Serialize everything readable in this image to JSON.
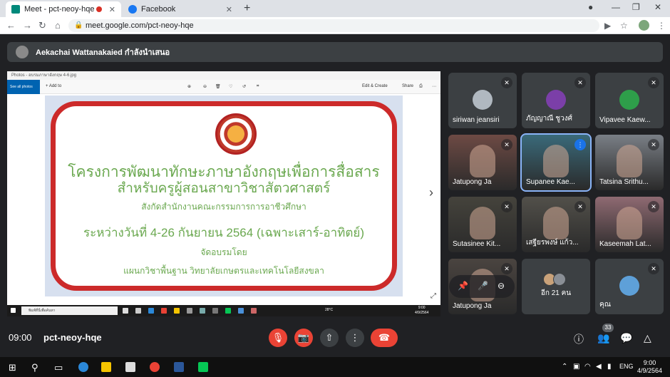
{
  "browser": {
    "tabs": [
      {
        "title": "Meet - pct-neoy-hqe",
        "active": true
      },
      {
        "title": "Facebook",
        "active": false
      }
    ],
    "url": "meet.google.com/pct-neoy-hqe"
  },
  "meet": {
    "presenter_text": "Aekachai Wattanakaied กำลังนำเสนอ",
    "meeting_time": "09:00",
    "meeting_code": "pct-neoy-hqe",
    "people_count": "33",
    "participants": [
      {
        "name": "siriwan jeansiri",
        "video": false,
        "color": "#b0b8c0"
      },
      {
        "name": "ภัญญาณี ชูวงศ์",
        "video": false,
        "color": "#7b3fa8"
      },
      {
        "name": "Vipavee Kaew...",
        "video": false,
        "color": "#2e9e4a"
      },
      {
        "name": "Jatupong Ja",
        "video": true,
        "color": "#6d4a44"
      },
      {
        "name": "Supanee Kae...",
        "video": true,
        "color": "#3a6a7a"
      },
      {
        "name": "Tatsina Srithu...",
        "video": true,
        "color": "#7a7f86"
      },
      {
        "name": "Sutasinee Kit...",
        "video": true,
        "color": "#45433c"
      },
      {
        "name": "เสฐียรพงษ์ แก้ว...",
        "video": true,
        "color": "#52504a"
      },
      {
        "name": "Kaseemah Lat...",
        "video": true,
        "color": "#8f6a72"
      },
      {
        "name": "Jatupong Ja",
        "video": true,
        "color": "#4a4440"
      },
      {
        "name": "อีก 21 คน",
        "video": false,
        "color": "#3c4043"
      },
      {
        "name": "คุณ",
        "video": false,
        "color": "#5ea0d8"
      }
    ]
  },
  "shared_screen": {
    "photos_title": "Photos - อบรมภาษาอังกฤษ 4-6.jpg",
    "see_all": "See all photos",
    "add_to": "Add to",
    "edit_create": "Edit & Create",
    "share": "Share",
    "slide": {
      "line1": "โครงการพัฒนาทักษะภาษาอังกฤษเพื่อการสื่อสาร",
      "line2": "สำหรับครูผู้สอนสาขาวิชาสัตวศาสตร์",
      "line3": "สังกัดสำนักงานคณะกรรมการการอาชีวศึกษา",
      "line4": "ระหว่างวันที่ 4-26 กันยายน 2564 (เฉพาะเสาร์-อาทิตย์)",
      "line5": "จัดอบรมโดย",
      "line6": "แผนกวิชาพื้นฐาน  วิทยาลัยเกษตรและเทคโนโลยีสงขลา"
    },
    "taskbar": {
      "search": "พิมพ์ที่นี่เพื่อค้นหา",
      "weather": "28°C",
      "time": "9:00",
      "date": "4/9/2564"
    }
  },
  "windows": {
    "lang": "ENG",
    "time": "9:00",
    "date": "4/9/2564"
  },
  "colors": {
    "meet_bg": "#202124",
    "tile_bg": "#3c4043",
    "red": "#ea4335",
    "slide_green": "#6aa84f",
    "slide_border": "#cc2a2a"
  }
}
